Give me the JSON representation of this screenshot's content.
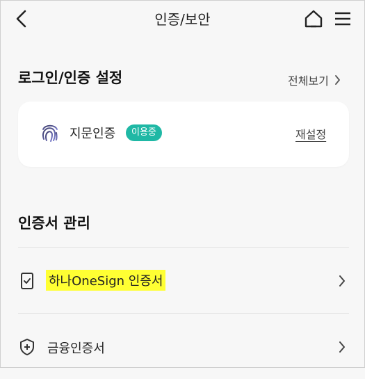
{
  "header": {
    "title": "인증/보안",
    "back_icon": "chevron-left-icon",
    "home_icon": "home-icon",
    "menu_icon": "hamburger-menu-icon"
  },
  "login_section": {
    "title": "로그인/인증 설정",
    "view_all": "전체보기"
  },
  "fingerprint_card": {
    "icon": "fingerprint-icon",
    "label": "지문인증",
    "status_badge": "이용중",
    "reset_link": "재설정",
    "badge_color": "#1fb8a5"
  },
  "certificate_section": {
    "title": "인증서 관리",
    "items": [
      {
        "icon": "certificate-check-icon",
        "label": "하나OneSign 인증서",
        "highlight": "#ffff33"
      },
      {
        "icon": "shield-plus-icon",
        "label": "금융인증서"
      }
    ]
  }
}
